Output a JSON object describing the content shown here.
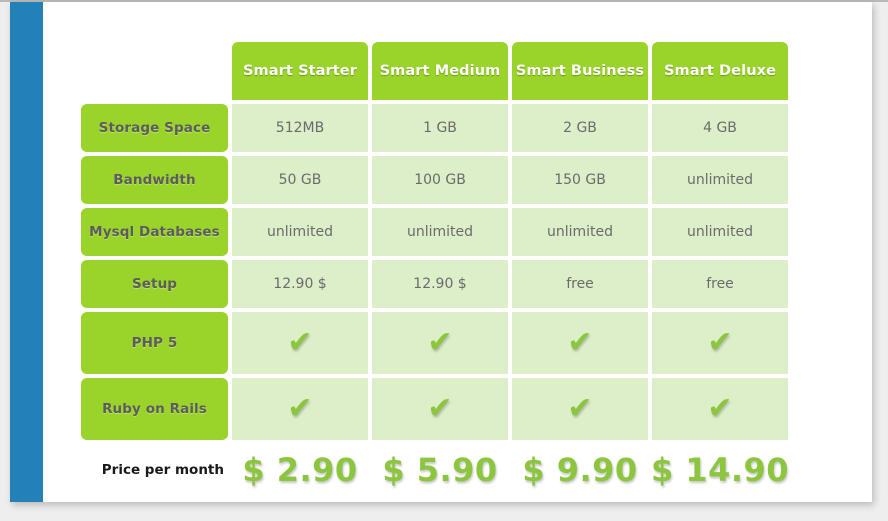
{
  "theme": {
    "accent_blue": "#2380b8",
    "header_green": "#9ad32a",
    "cell_green": "#dcefc8",
    "price_green": "#8cc63f",
    "page_background": "#eeeeee",
    "panel_background": "#ffffff"
  },
  "table": {
    "corner_label": "",
    "plans": [
      {
        "name": "Smart Starter"
      },
      {
        "name": "Smart Medium"
      },
      {
        "name": "Smart Business"
      },
      {
        "name": "Smart Deluxe"
      }
    ],
    "rows": [
      {
        "label": "Storage Space",
        "type": "text",
        "values": [
          "512MB",
          "1 GB",
          "2 GB",
          "4 GB"
        ]
      },
      {
        "label": "Bandwidth",
        "type": "text",
        "values": [
          "50 GB",
          "100 GB",
          "150 GB",
          "unlimited"
        ]
      },
      {
        "label": "Mysql Databases",
        "type": "text",
        "values": [
          "unlimited",
          "unlimited",
          "unlimited",
          "unlimited"
        ]
      },
      {
        "label": "Setup",
        "type": "text",
        "values": [
          "12.90 $",
          "12.90 $",
          "free",
          "free"
        ]
      },
      {
        "label": "PHP 5",
        "type": "check",
        "values": [
          "✔",
          "✔",
          "✔",
          "✔"
        ]
      },
      {
        "label": "Ruby on Rails",
        "type": "check",
        "values": [
          "✔",
          "✔",
          "✔",
          "✔"
        ]
      }
    ],
    "price_row": {
      "label": "Price per month",
      "values": [
        "$ 2.90",
        "$ 5.90",
        "$ 9.90",
        "$ 14.90"
      ]
    }
  }
}
